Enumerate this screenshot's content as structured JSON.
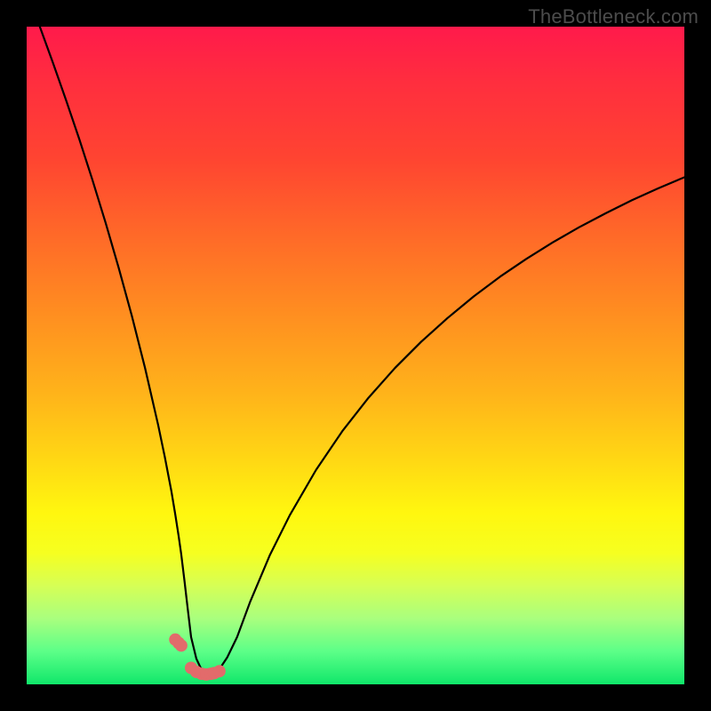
{
  "watermark": "TheBottleneck.com",
  "chart_data": {
    "type": "line",
    "title": "",
    "xlabel": "",
    "ylabel": "",
    "x_range": [
      0,
      100
    ],
    "y_range": [
      0,
      100
    ],
    "grid": false,
    "legend": false,
    "curve": {
      "name": "bottleneck-curve",
      "color": "#000000",
      "x": [
        2,
        4,
        6,
        8,
        10,
        12,
        14,
        16,
        18,
        20,
        21,
        22,
        22.6,
        23.1,
        23.5,
        24,
        24.5,
        25,
        25.8,
        26.6,
        27.3,
        28,
        28.5,
        29.3,
        30.5,
        32,
        34,
        37,
        40,
        44,
        48,
        52,
        56,
        60,
        64,
        68,
        72,
        76,
        80,
        84,
        88,
        92,
        96,
        100
      ],
      "y": [
        100,
        94.5,
        88.8,
        82.9,
        76.7,
        70.2,
        63.3,
        56,
        48.1,
        39.4,
        34.6,
        29.4,
        25.8,
        22.6,
        19.8,
        15.7,
        11.4,
        7.2,
        3.9,
        2.2,
        1.6,
        1.6,
        1.8,
        2.3,
        4.1,
        7.2,
        12.6,
        19.7,
        25.7,
        32.6,
        38.5,
        43.6,
        48.1,
        52.1,
        55.7,
        59,
        62,
        64.7,
        67.2,
        69.5,
        71.6,
        73.6,
        75.4,
        77.1
      ]
    },
    "markers": {
      "name": "highlight-points",
      "color": "#e26b6b",
      "x": [
        22.6,
        23.1,
        23.5,
        25.0,
        25.8,
        26.6,
        27.3,
        28.0,
        28.5,
        29.3
      ],
      "y": [
        6.8,
        6.3,
        5.9,
        2.5,
        1.9,
        1.6,
        1.5,
        1.6,
        1.7,
        2.0
      ]
    }
  }
}
